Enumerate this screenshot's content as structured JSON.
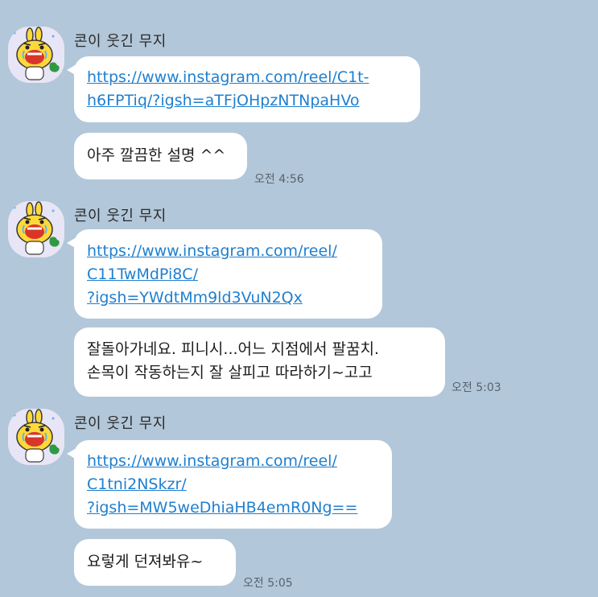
{
  "messages": [
    {
      "sender": "콘이 웃긴 무지",
      "link_lines": [
        "https://www.instagram.com/reel/C1t-",
        "h6FPTiq/?igsh=aTFjOHpzNTNpaHVo"
      ],
      "text_lines": [
        "아주 깔끔한 설명 ^^"
      ],
      "time": "오전 4:56"
    },
    {
      "sender": "콘이 웃긴 무지",
      "link_lines": [
        "https://www.instagram.com/reel/",
        "C11TwMdPi8C/",
        "?igsh=YWdtMm9ld3VuN2Qx"
      ],
      "text_lines": [
        "잘돌아가네요. 피니시...어느 지점에서 팔꿈치.",
        "손목이 작동하는지 잘 살피고 따라하기~고고"
      ],
      "time": "오전 5:03"
    },
    {
      "sender": "콘이 웃긴 무지",
      "link_lines": [
        "https://www.instagram.com/reel/",
        "C1tni2NSkzr/",
        "?igsh=MW5weDhiaHB4emR0Ng=="
      ],
      "text_lines": [
        "요렇게 던져봐유~"
      ],
      "time": "오전 5:05"
    }
  ],
  "icons": {
    "avatar": "muzi-character-icon"
  },
  "colors": {
    "background": "#b2c7d9",
    "bubble": "#ffffff",
    "link": "#1f7fcf",
    "text": "#1c1c1c",
    "time": "#58636e"
  }
}
